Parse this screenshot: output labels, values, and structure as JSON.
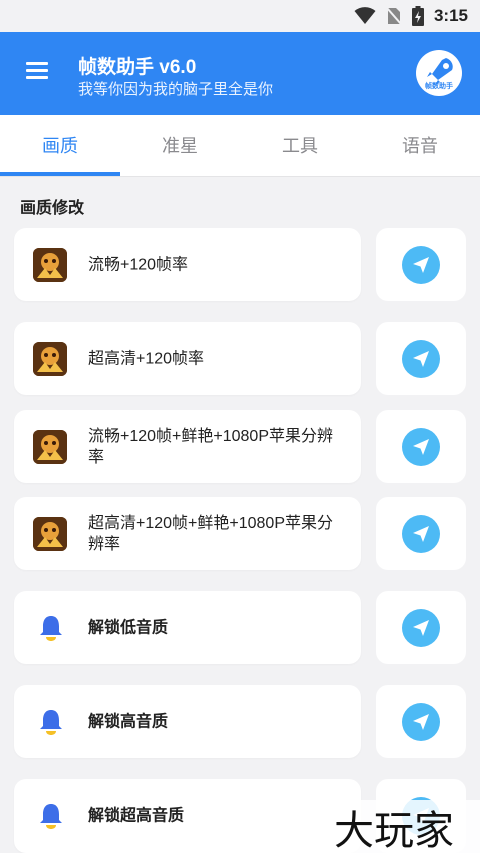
{
  "status_bar": {
    "time": "3:15"
  },
  "app_bar": {
    "title": "帧数助手 v6.0",
    "subtitle": "我等你因为我的脑子里全是你",
    "logo_text": "帧数助手"
  },
  "tabs": [
    {
      "label": "画质",
      "active": true
    },
    {
      "label": "准星",
      "active": false
    },
    {
      "label": "工具",
      "active": false
    },
    {
      "label": "语音",
      "active": false
    }
  ],
  "section": {
    "title": "画质修改"
  },
  "items": [
    {
      "label": "流畅+120帧率",
      "icon": "game-icon"
    },
    {
      "label": "超高清+120帧率",
      "icon": "game-icon"
    },
    {
      "label": "流畅+120帧+鲜艳+1080P苹果分辨率",
      "icon": "game-icon"
    },
    {
      "label": "超高清+120帧+鲜艳+1080P苹果分辨率",
      "icon": "game-icon"
    },
    {
      "label": "解锁低音质",
      "icon": "bell-icon"
    },
    {
      "label": "解锁高音质",
      "icon": "bell-icon"
    },
    {
      "label": "解锁超高音质",
      "icon": "bell-icon"
    }
  ],
  "watermark": "大玩家",
  "colors": {
    "primary": "#2f86f3",
    "action": "#4dbaf5",
    "background": "#f2f2f4"
  }
}
